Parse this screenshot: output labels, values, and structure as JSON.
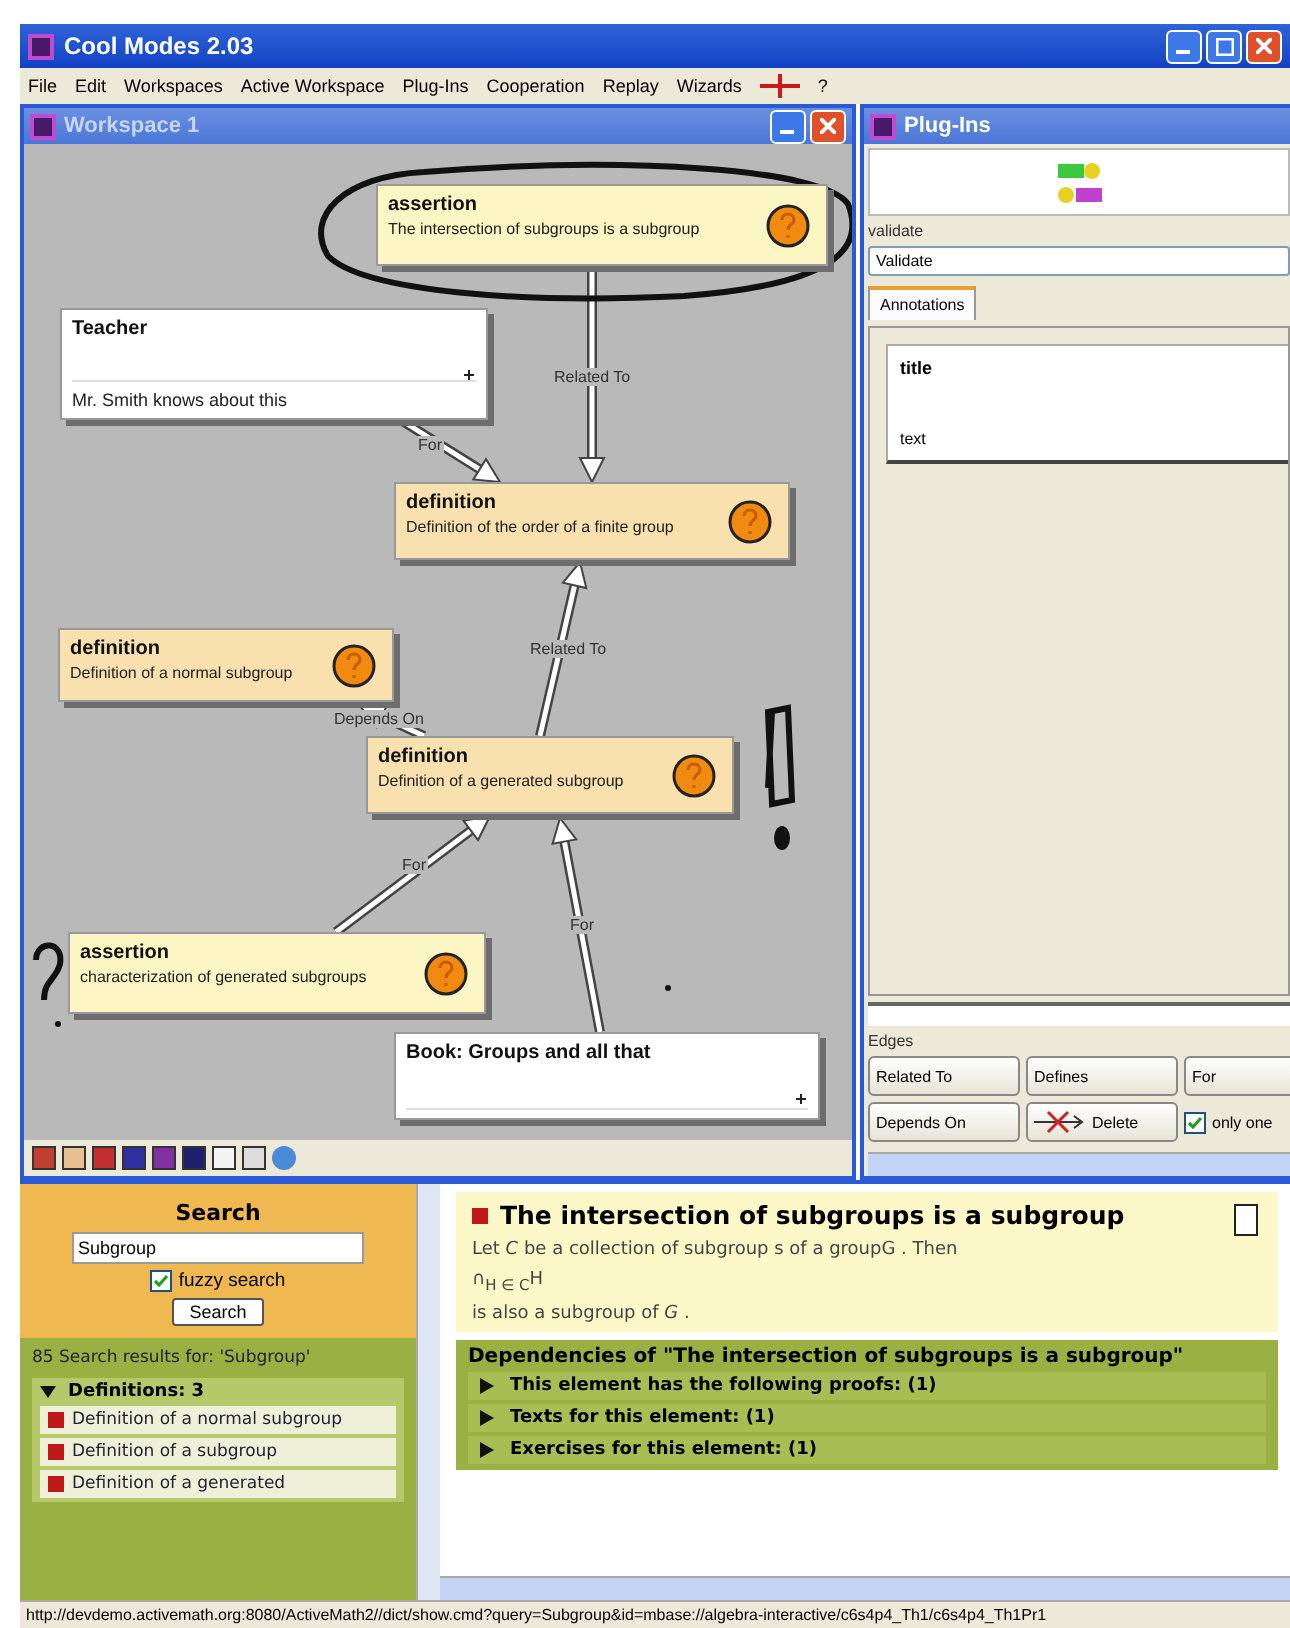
{
  "app": {
    "title": "Cool Modes 2.03"
  },
  "menu": {
    "items": [
      "File",
      "Edit",
      "Workspaces",
      "Active Workspace",
      "Plug-Ins",
      "Cooperation",
      "Replay",
      "Wizards"
    ],
    "help": "?"
  },
  "workspace": {
    "title": "Workspace 1",
    "nodes": [
      {
        "kind": "assertion",
        "title": "assertion",
        "text": "The intersection of subgroups is a subgroup"
      },
      {
        "kind": "note",
        "title": "Teacher",
        "text": "Mr. Smith knows about this"
      },
      {
        "kind": "definition",
        "title": "definition",
        "text": "Definition of the order of a finite group"
      },
      {
        "kind": "definition",
        "title": "definition",
        "text": "Definition of a normal subgroup"
      },
      {
        "kind": "definition",
        "title": "definition",
        "text": "Definition of a generated subgroup"
      },
      {
        "kind": "assertion",
        "title": "assertion",
        "text": "characterization of generated subgroups"
      },
      {
        "kind": "note",
        "title": "Book: Groups and all that"
      }
    ],
    "edges": [
      {
        "label": "Related To"
      },
      {
        "label": "For"
      },
      {
        "label": "Related To"
      },
      {
        "label": "Depends On"
      },
      {
        "label": "For"
      },
      {
        "label": "For"
      }
    ]
  },
  "plugins": {
    "title": "Plug-Ins",
    "validate": {
      "label": "validate",
      "value": "Validate"
    },
    "tabs": [
      {
        "label": "Annotations",
        "selected": true
      }
    ],
    "annotation": {
      "title": "title",
      "text": "text"
    },
    "edges": {
      "label": "Edges",
      "buttons": [
        {
          "kind": "edge",
          "label": "Related To"
        },
        {
          "kind": "edge",
          "label": "Defines"
        },
        {
          "kind": "edge",
          "label": "For"
        },
        {
          "kind": "edge",
          "label": "Depends On"
        },
        {
          "kind": "delete",
          "label": "Delete"
        }
      ],
      "only_one": {
        "label": "only one",
        "checked": true
      }
    }
  },
  "search": {
    "title": "Search",
    "query": "Subgroup",
    "fuzzy": {
      "label": "fuzzy search",
      "checked": true
    },
    "button": "Search",
    "results_header": "85 Search results for: 'Subgroup'",
    "sections": [
      {
        "label": "Definitions: 3",
        "expanded": true,
        "items": [
          "Definition of a normal subgroup",
          "Definition of a subgroup",
          "Definition of a generated"
        ]
      }
    ]
  },
  "article": {
    "title": "The intersection of subgroups is a subgroup",
    "lines": [
      "Let *C* be a collection of subgroup s of a groupG . Then",
      "∩$_{H ∈ C}$H",
      "is also a subgroup of *G* ."
    ],
    "dependencies": {
      "title": "Dependencies of \"The intersection of subgroups is a subgroup\"",
      "rows": [
        {
          "label": "This element has the following proofs: (1)",
          "expanded": false
        },
        {
          "label": "Texts for this element: (1)",
          "expanded": false
        },
        {
          "label": "Exercises for this element: (1)",
          "expanded": false
        }
      ]
    }
  },
  "status_bar": "http://devdemo.activemath.org:8080/ActiveMath2//dict/show.cmd?query=Subgroup&id=mbase://algebra-interactive/c6s4p4_Th1/c6s4p4_Th1Pr1"
}
